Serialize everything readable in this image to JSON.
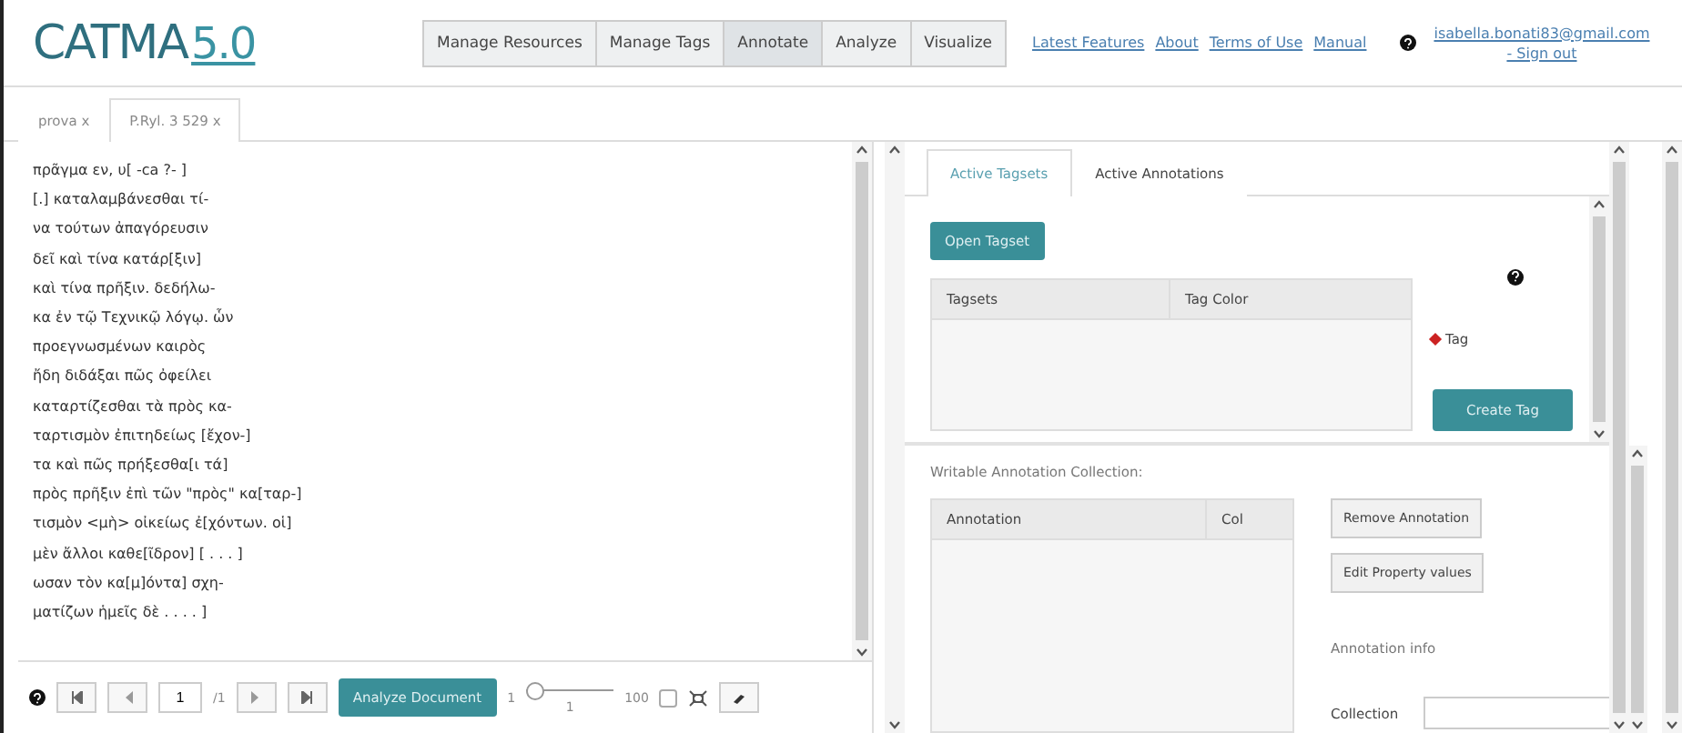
{
  "logo": {
    "name": "CATMA",
    "version": "5.0"
  },
  "nav": [
    {
      "label": "Manage Resources",
      "selected": false
    },
    {
      "label": "Manage Tags",
      "selected": false
    },
    {
      "label": "Annotate",
      "selected": true
    },
    {
      "label": "Analyze",
      "selected": false
    },
    {
      "label": "Visualize",
      "selected": false
    }
  ],
  "links": [
    "Latest Features",
    "About",
    "Terms of Use",
    "Manual"
  ],
  "user": {
    "email": "isabella.bonati83@gmail.com",
    "sign_out": "- Sign out"
  },
  "document_tabs": [
    {
      "label": "prova",
      "close": "x",
      "selected": false
    },
    {
      "label": "P.Ryl. 3 529",
      "close": "x",
      "selected": true
    }
  ],
  "document_lines": [
    "πρᾶγμα εν, υ[ -ca ?- ]",
    "[.] καταλαμβάνεσθαι τί-",
    "να τούτων ἀπαγόρευσιν",
    "δεῖ καὶ τίνα κατάρ[ξιν]",
    "καὶ τίνα πρῆξιν. δεδήλω-",
    "κα ἐν τῷ Τεχνικῷ λόγῳ. ὧν",
    "προεγνωσμένων καιρὸς",
    "ἤδη διδάξαι πῶς ὀφείλει",
    "καταρτίζεσθαι τὰ πρὸς κα-",
    "ταρτισμὸν ἐπιτηδείως [ἔχον-]",
    "τα καὶ πῶς πρήξεσθα[ι τά]",
    "πρὸς πρῆξιν ἐπὶ τῶν \"πρὸς\" κα[ταρ-]",
    "τισμὸν <μὴ> οἰκείως ἐ[χόντων. οἱ]",
    "μὲν ἄλλοι καθε[ῖδρον] [ . . . ]",
    "ωσαν τὸν κα[μ]όντα] σχη-",
    "ματίζων ἡμεῖς δὲ . . . . ]"
  ],
  "pager": {
    "page": "1",
    "total": "/1",
    "analyze_button": "Analyze Document",
    "slider_min": "1",
    "slider_max": "100",
    "slider_value": "1",
    "level": 0.0,
    "checked": false
  },
  "side_tabs": [
    {
      "label": "Active Tagsets",
      "selected": true
    },
    {
      "label": "Active Annotations",
      "selected": false
    }
  ],
  "tagsets": {
    "open_button": "Open Tagset",
    "columns": [
      "Tagsets",
      "Tag Color"
    ],
    "tag": {
      "label": "Tag",
      "color": "#cc2222"
    },
    "create_button": "Create Tag"
  },
  "annotations": {
    "title": "Writable Annotation Collection:",
    "columns": [
      "Annotation",
      "Col"
    ],
    "buttons": [
      "Remove Annotation",
      "Edit Property values"
    ],
    "info_title": "Annotation info",
    "collection_label": "Collection"
  }
}
